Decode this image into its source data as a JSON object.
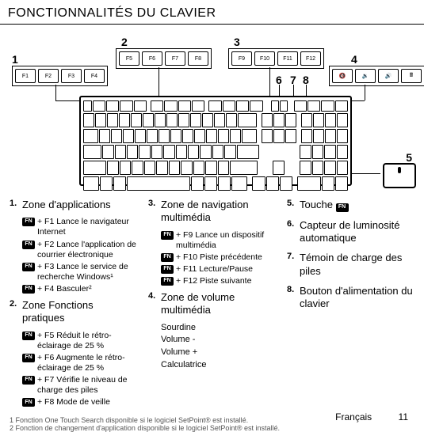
{
  "title": "FONCTIONNALITÉS DU CLAVIER",
  "callouts": {
    "g1": [
      "F1",
      "F2",
      "F3",
      "F4"
    ],
    "g2": [
      "F5",
      "F6",
      "F7",
      "F8"
    ],
    "g3": [
      "F9",
      "F10",
      "F11",
      "F12"
    ],
    "g4": [
      "🔇",
      "🔉",
      "🔊",
      "🖩"
    ]
  },
  "labels": {
    "n1": "1",
    "n2": "2",
    "n3": "3",
    "n4": "4",
    "n5": "5",
    "n6": "6",
    "n7": "7",
    "n8": "8"
  },
  "fn_label": "FN",
  "list": {
    "i1": {
      "title": "Zone d'applications",
      "subs": [
        "+ F1 Lance le navigateur Internet",
        "+ F2 Lance l'application de courrier électronique",
        "+ F3 Lance le service de recherche Windows¹",
        "+ F4 Basculer²"
      ]
    },
    "i2": {
      "title": "Zone Fonctions pratiques",
      "subs": [
        "+ F5 Réduit le rétro-éclairage de 25 %",
        "+ F6 Augmente le rétro-éclairage de 25 %",
        "+ F7 Vérifie le niveau de charge des piles",
        "+ F8 Mode de veille"
      ]
    },
    "i3": {
      "title": "Zone de navigation multimédia",
      "subs": [
        "+ F9 Lance un dispositif multimédia",
        "+ F10 Piste précédente",
        "+ F11 Lecture/Pause",
        "+ F12 Piste suivante"
      ]
    },
    "i4": {
      "title": "Zone de volume multimédia",
      "plain": [
        "Sourdine",
        "Volume -",
        "Volume +",
        "Calculatrice"
      ]
    },
    "i5": {
      "title": "Touche "
    },
    "i6": {
      "title": "Capteur de luminosité automatique"
    },
    "i7": {
      "title": "Témoin de charge des piles"
    },
    "i8": {
      "title": "Bouton d'alimentation du clavier"
    }
  },
  "footnotes": {
    "f1": "1   Fonction One Touch Search disponible si le logiciel SetPoint® est installé.",
    "f2": "2   Fonction de changement d'application disponible si le logiciel SetPoint® est installé."
  },
  "footer": {
    "lang": "Français",
    "page": "11"
  }
}
